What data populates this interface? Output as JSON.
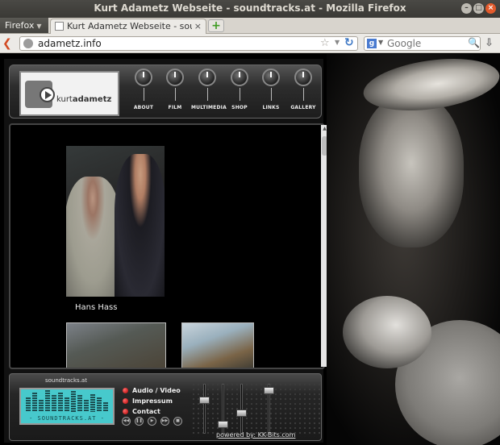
{
  "window": {
    "title": "Kurt Adametz Webseite - soundtracks.at - Mozilla Firefox"
  },
  "browser": {
    "menu_label": "Firefox",
    "tab_title": "Kurt Adametz Webseite - soun...",
    "url": "adametz.info",
    "search_placeholder": "Google",
    "search_engine": "google-icon"
  },
  "site": {
    "logo_text_light": "kurt",
    "logo_text_bold": "adametz",
    "nav": [
      {
        "label": "ABOUT"
      },
      {
        "label": "FILM"
      },
      {
        "label": "MULTIMEDIA"
      },
      {
        "label": "SHOP"
      },
      {
        "label": "LINKS"
      },
      {
        "label": "GALLERY"
      }
    ],
    "photo_caption": "Hans Hass",
    "player": {
      "site_label": "soundtracks.at",
      "lcd_text": "- SOUNDTRACKS.AT -",
      "menu": [
        {
          "label": "Audio / Video"
        },
        {
          "label": "Impressum"
        },
        {
          "label": "Contact"
        }
      ],
      "controls": [
        "rewind-icon",
        "pause-icon",
        "play-icon",
        "forward-icon",
        "stop-icon"
      ]
    },
    "powered_by": "powered by: KK-Bits.com"
  },
  "colors": {
    "lcd": "#47c9cc",
    "menu_dot": "#d01010",
    "accent": "#e25a2c"
  }
}
